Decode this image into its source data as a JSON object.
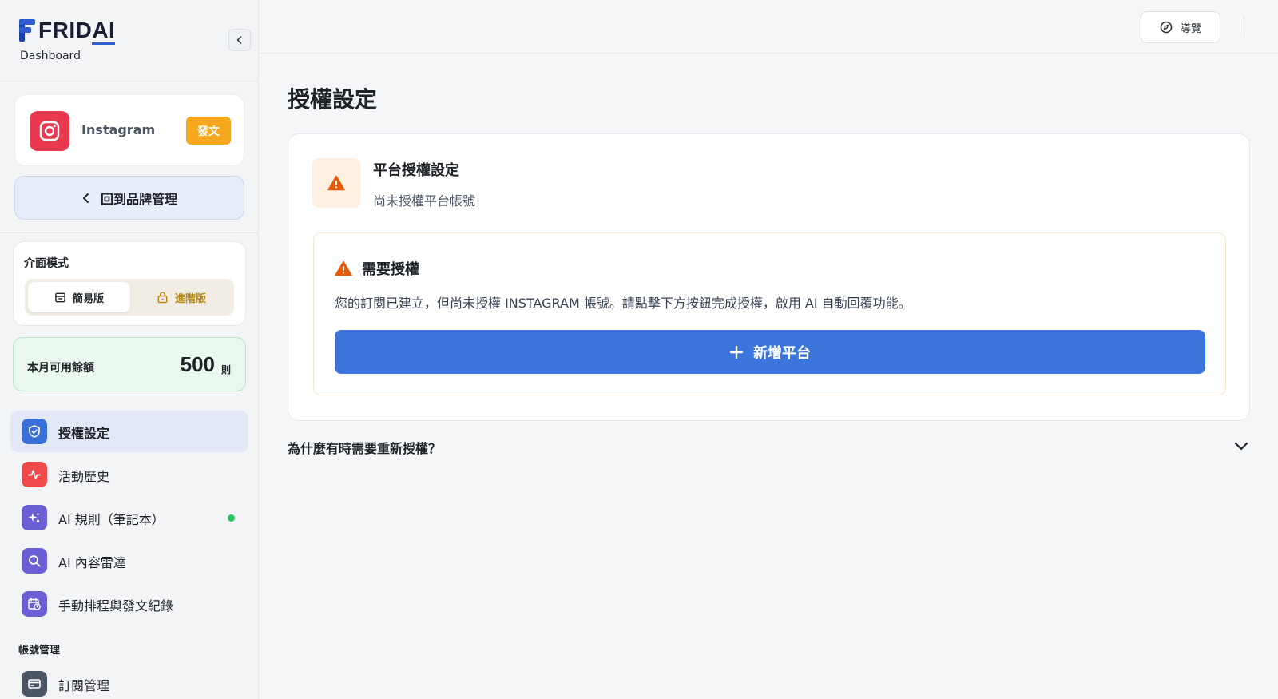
{
  "brand": {
    "logo_letters": "FRID",
    "logo_ai": "AI",
    "subtitle": "Dashboard"
  },
  "platform": {
    "name": "Instagram",
    "badge": "發文"
  },
  "back_button": {
    "label": "回到品牌管理"
  },
  "mode": {
    "title": "介面模式",
    "simple_label": "簡易版",
    "advanced_label": "進階版"
  },
  "quota": {
    "label": "本月可用餘額",
    "value": "500",
    "unit": "則"
  },
  "nav": {
    "items": [
      {
        "label": "授權設定",
        "color": "#3b6fd8"
      },
      {
        "label": "活動歷史",
        "color": "#ef4a4a"
      },
      {
        "label": "AI 規則（筆記本）",
        "color": "#6b5fd6"
      },
      {
        "label": "AI 內容雷達",
        "color": "#6b5fd6"
      },
      {
        "label": "手動排程與發文紀錄",
        "color": "#6b5fd6"
      }
    ],
    "section_title": "帳號管理",
    "account_items": [
      {
        "label": "訂閱管理",
        "color": "#4b5563"
      }
    ]
  },
  "topbar": {
    "guide_label": "導覽"
  },
  "page": {
    "title": "授權設定"
  },
  "panel": {
    "title": "平台授權設定",
    "subtitle": "尚未授權平台帳號",
    "alert_title": "需要授權",
    "alert_message": "您的訂閱已建立，但尚未授權 INSTAGRAM 帳號。請點擊下方按鈕完成授權，啟用 AI 自動回覆功能。",
    "add_button": "新增平台"
  },
  "faq": {
    "question": "為什麼有時需要重新授權？"
  },
  "colors": {
    "primary": "#3b74db",
    "warning": "#e8590c",
    "instagram": "#e8394f",
    "badge": "#f6a81d",
    "success": "#22c55e"
  }
}
